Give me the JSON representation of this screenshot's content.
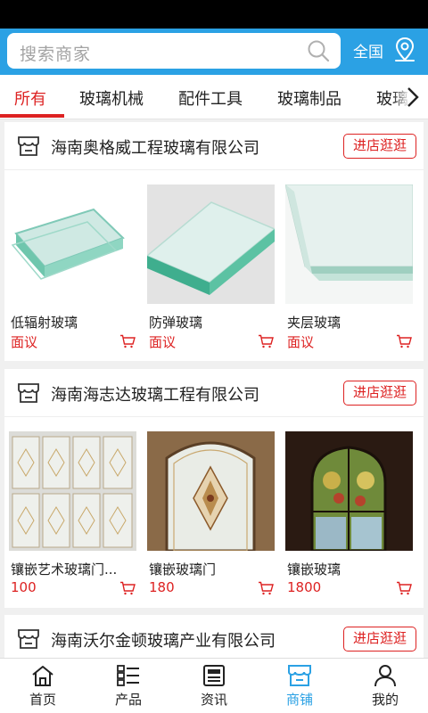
{
  "search": {
    "placeholder": "搜索商家"
  },
  "region": {
    "label": "全国"
  },
  "tabs": [
    {
      "label": "所有"
    },
    {
      "label": "玻璃机械"
    },
    {
      "label": "配件工具"
    },
    {
      "label": "玻璃制品"
    },
    {
      "label": "玻璃"
    }
  ],
  "colors": {
    "accent": "#2ba1e4",
    "active_tab": "#dd2222",
    "price": "#dd2222"
  },
  "shops": [
    {
      "name": "海南奥格威工程玻璃有限公司",
      "visit_label": "进店逛逛",
      "products": [
        {
          "name": "低辐射玻璃",
          "price": "面议"
        },
        {
          "name": "防弹玻璃",
          "price": "面议"
        },
        {
          "name": "夹层玻璃",
          "price": "面议"
        }
      ]
    },
    {
      "name": "海南海志达玻璃工程有限公司",
      "visit_label": "进店逛逛",
      "products": [
        {
          "name": "镶嵌艺术玻璃门...",
          "price": "100"
        },
        {
          "name": "镶嵌玻璃门",
          "price": "180"
        },
        {
          "name": "镶嵌玻璃",
          "price": "1800"
        }
      ]
    },
    {
      "name": "海南沃尔金顿玻璃产业有限公司",
      "visit_label": "进店逛逛",
      "products": []
    }
  ],
  "bottom_nav": [
    {
      "label": "首页",
      "icon": "home-icon"
    },
    {
      "label": "产品",
      "icon": "list-icon"
    },
    {
      "label": "资讯",
      "icon": "news-icon"
    },
    {
      "label": "商铺",
      "icon": "store-icon",
      "active": true
    },
    {
      "label": "我的",
      "icon": "user-icon"
    }
  ]
}
